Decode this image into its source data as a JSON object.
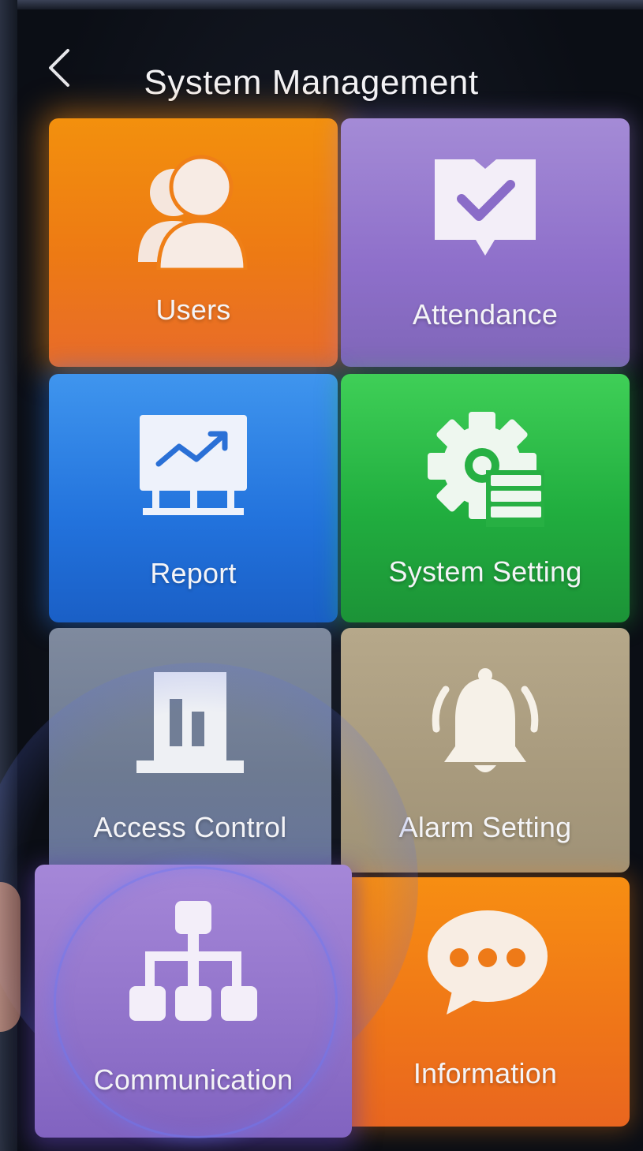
{
  "header": {
    "back_icon": "chevron-left-icon",
    "title": "System Management"
  },
  "tiles": [
    {
      "label": "Users",
      "icon": "users-icon",
      "color": "#ed7a14"
    },
    {
      "label": "Attendance",
      "icon": "attendance-check-icon",
      "color": "#8e6fca"
    },
    {
      "label": "Report",
      "icon": "report-chart-icon",
      "color": "#2272dc"
    },
    {
      "label": "System Setting",
      "icon": "gear-settings-icon",
      "color": "#21ae3f"
    },
    {
      "label": "Access Control",
      "icon": "door-icon",
      "color": "#6d7a92"
    },
    {
      "label": "Alarm Setting",
      "icon": "bell-icon",
      "color": "#a89a7d"
    },
    {
      "label": "Communication",
      "icon": "network-icon",
      "color": "#9274cb"
    },
    {
      "label": "Information",
      "icon": "chat-bubble-icon",
      "color": "#ef7518"
    }
  ]
}
